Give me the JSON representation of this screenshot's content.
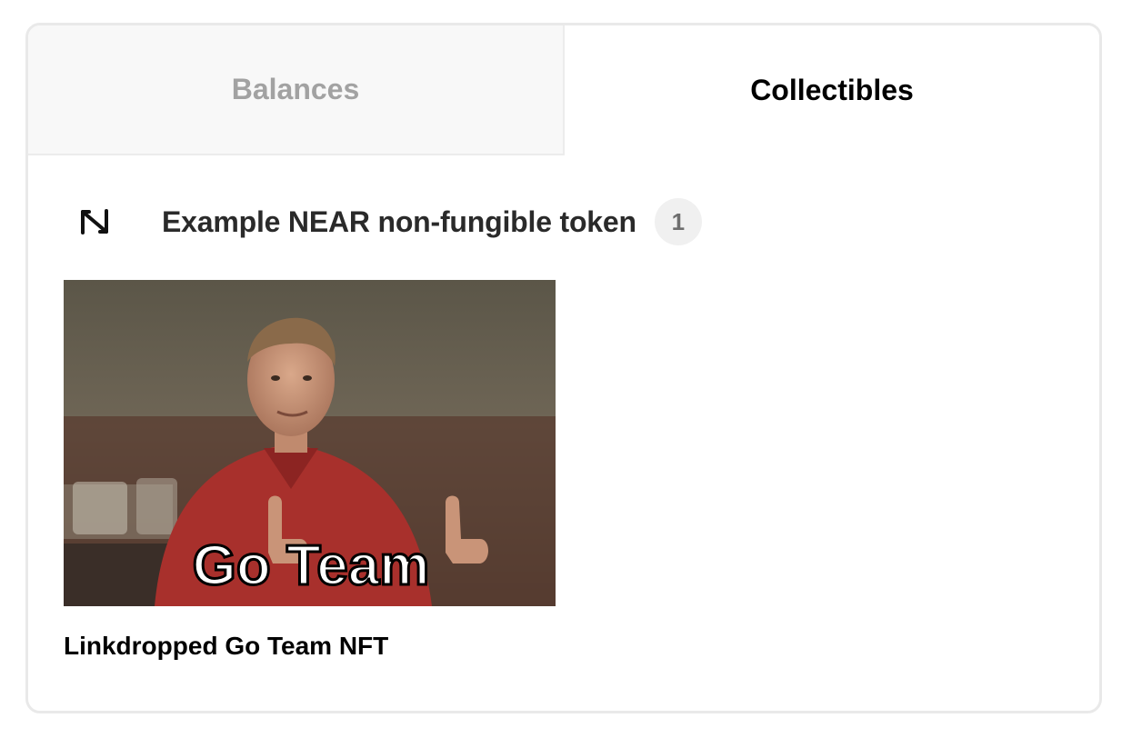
{
  "tabs": [
    {
      "label": "Balances",
      "active": false
    },
    {
      "label": "Collectibles",
      "active": true
    }
  ],
  "collection": {
    "logo_icon": "near-logo-icon",
    "title": "Example NEAR non-fungible token",
    "count": "1"
  },
  "nfts": [
    {
      "name": "Linkdropped Go Team NFT",
      "image_caption": "Go Team"
    }
  ],
  "colors": {
    "active_tab_text": "#000000",
    "inactive_tab_text": "#a2a2a2",
    "inactive_tab_bg": "#f8f8f8",
    "badge_bg": "#f0f0f0",
    "card_border": "#e9e9e9"
  }
}
